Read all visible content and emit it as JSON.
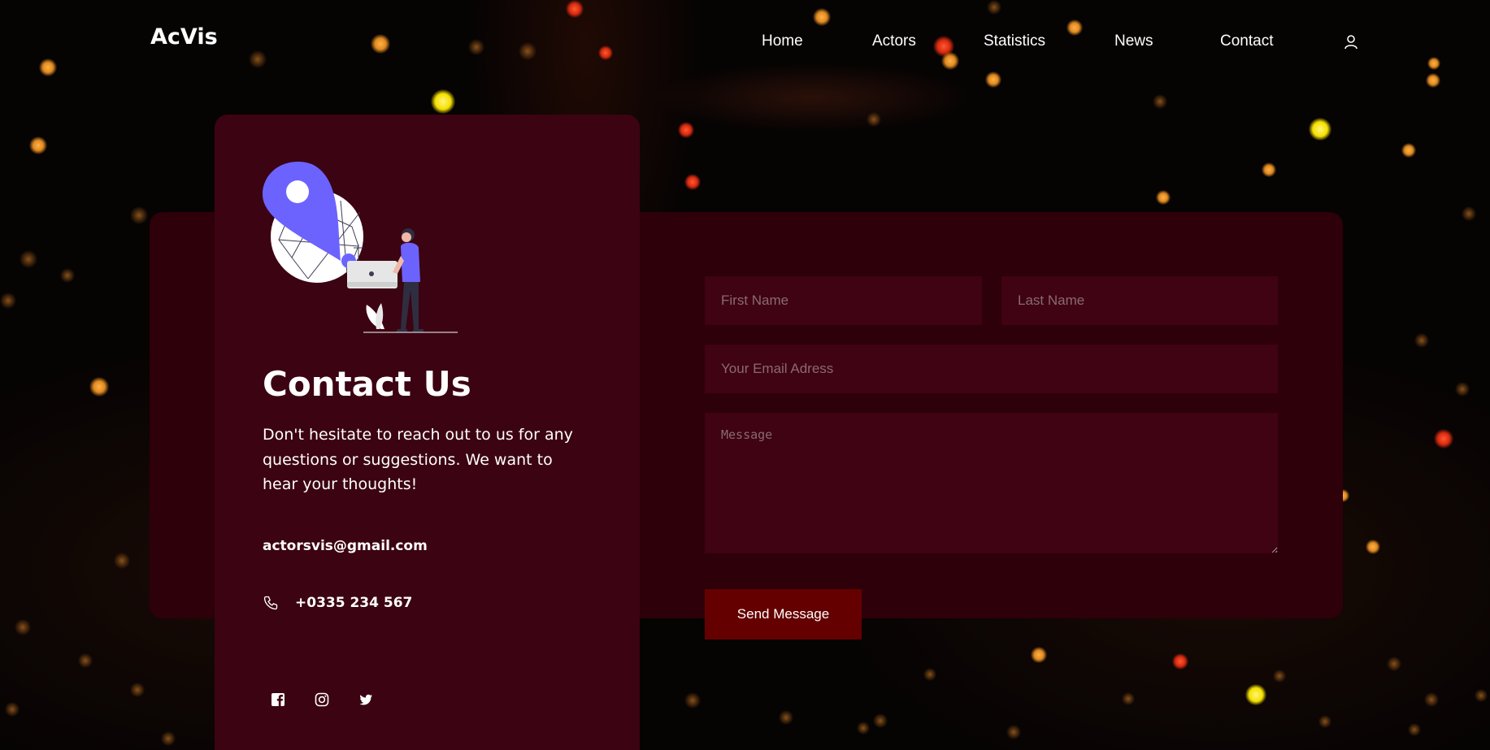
{
  "nav": {
    "logo": "AcVis",
    "links": [
      "Home",
      "Actors",
      "Statistics",
      "News",
      "Contact"
    ],
    "user_icon": "user-icon"
  },
  "contact": {
    "title": "Contact Us",
    "description": "Don't hesitate to reach out to us for any questions or suggestions. We want to hear your thoughts!",
    "email": "actorsvis@gmail.com",
    "phone": "+0335 234 567",
    "social_icons": [
      "facebook-icon",
      "instagram-icon",
      "twitter-icon"
    ]
  },
  "form": {
    "first_name_placeholder": "First Name",
    "last_name_placeholder": "Last Name",
    "email_placeholder": "Your Email Adress",
    "message_placeholder": "Message",
    "submit_label": "Send Message"
  },
  "colors": {
    "page_bg": "#060303",
    "band_bg": "#2e0009",
    "card_bg": "#3c0312",
    "input_bg": "#3f0313",
    "button_bg": "#650000",
    "illustration_accent": "#6c63ff"
  }
}
